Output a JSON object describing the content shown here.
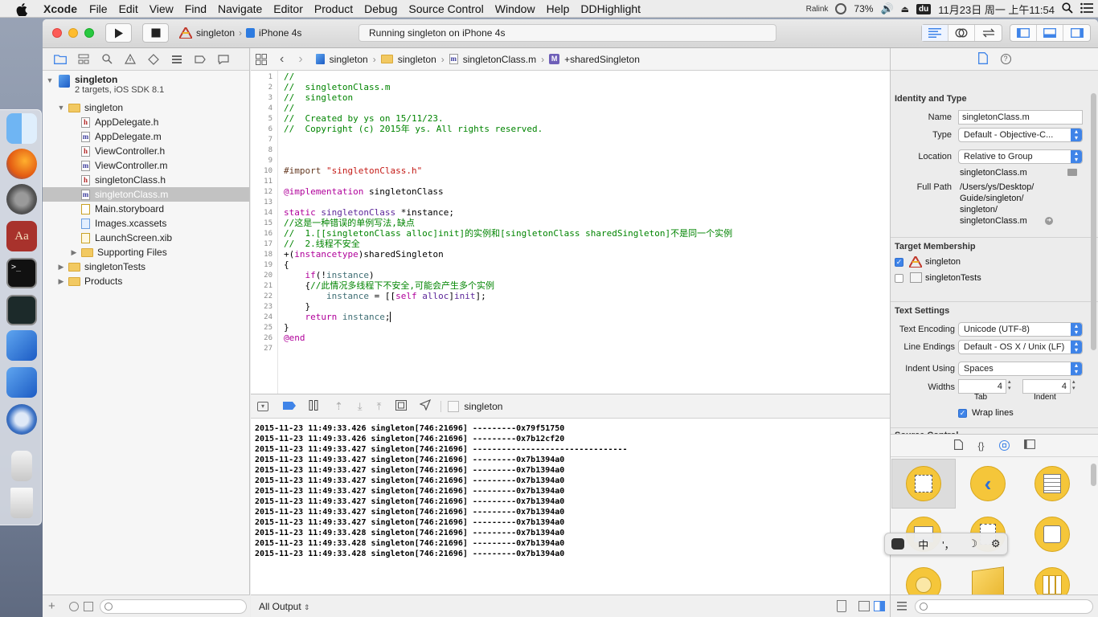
{
  "menubar": {
    "app_name": "Xcode",
    "items": [
      "File",
      "Edit",
      "View",
      "Find",
      "Navigate",
      "Editor",
      "Product",
      "Debug",
      "Source Control",
      "Window",
      "Help",
      "DDHighlight"
    ],
    "wifi_label": "Ralink",
    "battery": "73%",
    "baidu": "du",
    "datetime": "11月23日 周一 上午11:54"
  },
  "toolbar": {
    "scheme_target": "singleton",
    "scheme_device": "iPhone 4s",
    "activity": "Running singleton on iPhone 4s"
  },
  "navigator": {
    "project_name": "singleton",
    "project_subtitle": "2 targets, iOS SDK 8.1",
    "items": [
      {
        "label": "singleton",
        "kind": "folder",
        "indent": 1,
        "open": true
      },
      {
        "label": "AppDelegate.h",
        "kind": "h",
        "indent": 2
      },
      {
        "label": "AppDelegate.m",
        "kind": "m",
        "indent": 2
      },
      {
        "label": "ViewController.h",
        "kind": "h",
        "indent": 2
      },
      {
        "label": "ViewController.m",
        "kind": "m",
        "indent": 2
      },
      {
        "label": "singletonClass.h",
        "kind": "h",
        "indent": 2
      },
      {
        "label": "singletonClass.m",
        "kind": "m",
        "indent": 2,
        "selected": true
      },
      {
        "label": "Main.storyboard",
        "kind": "storyboard",
        "indent": 2
      },
      {
        "label": "Images.xcassets",
        "kind": "assets",
        "indent": 2
      },
      {
        "label": "LaunchScreen.xib",
        "kind": "xib",
        "indent": 2
      },
      {
        "label": "Supporting Files",
        "kind": "folder",
        "indent": 2,
        "open": false
      },
      {
        "label": "singletonTests",
        "kind": "folder",
        "indent": 1,
        "open": false
      },
      {
        "label": "Products",
        "kind": "folder",
        "indent": 1,
        "open": false
      }
    ]
  },
  "jumpbar": {
    "crumbs": [
      "singleton",
      "singleton",
      "singletonClass.m",
      "+sharedSingleton"
    ]
  },
  "code_lines": [
    {
      "n": "1",
      "t": "//",
      "c": "com"
    },
    {
      "n": "2",
      "t": "//  singletonClass.m",
      "c": "com"
    },
    {
      "n": "3",
      "t": "//  singleton",
      "c": "com"
    },
    {
      "n": "4",
      "t": "//",
      "c": "com"
    },
    {
      "n": "5",
      "t": "//  Created by ys on 15/11/23.",
      "c": "com"
    },
    {
      "n": "6",
      "t": "//  Copyright (c) 2015年 ys. All rights reserved.",
      "c": "com"
    },
    {
      "n": "7",
      "t": "",
      "c": ""
    },
    {
      "n": "8",
      "t": "",
      "c": ""
    },
    {
      "n": "9",
      "t": "",
      "c": ""
    },
    {
      "n": "10",
      "t": "#import \"singletonClass.h\"",
      "c": "import"
    },
    {
      "n": "11",
      "t": "",
      "c": ""
    },
    {
      "n": "12",
      "t": "@implementation singletonClass",
      "c": "impl"
    },
    {
      "n": "13",
      "t": "",
      "c": ""
    },
    {
      "n": "14",
      "t": "static singletonClass *instance;",
      "c": "static"
    },
    {
      "n": "15",
      "t": "//这是一种错误的单例写法,缺点",
      "c": "com"
    },
    {
      "n": "16",
      "t": "//  1.[[singletonClass alloc]init]的实例和[singletonClass sharedSingleton]不是同一个实例",
      "c": "com"
    },
    {
      "n": "17",
      "t": "//  2.线程不安全",
      "c": "com"
    },
    {
      "n": "18",
      "t": "+(instancetype)sharedSingleton",
      "c": "method"
    },
    {
      "n": "19",
      "t": "{",
      "c": ""
    },
    {
      "n": "20",
      "t": "    if(!instance)",
      "c": "if"
    },
    {
      "n": "21",
      "t": "    {//此情况多线程下不安全,可能会产生多个实例",
      "c": "brace-com"
    },
    {
      "n": "22",
      "t": "        instance = [[self alloc]init];",
      "c": "assign"
    },
    {
      "n": "23",
      "t": "    }",
      "c": ""
    },
    {
      "n": "24",
      "t": "    return instance;",
      "c": "return"
    },
    {
      "n": "25",
      "t": "}",
      "c": ""
    },
    {
      "n": "26",
      "t": "@end",
      "c": "end"
    },
    {
      "n": "27",
      "t": "",
      "c": ""
    }
  ],
  "debugbar": {
    "process": "singleton"
  },
  "console_lines": [
    "2015-11-23 11:49:33.426 singleton[746:21696] ---------0x79f51750",
    "2015-11-23 11:49:33.426 singleton[746:21696] ---------0x7b12cf20",
    "2015-11-23 11:49:33.427 singleton[746:21696] --------------------------------",
    "2015-11-23 11:49:33.427 singleton[746:21696] ---------0x7b1394a0",
    "2015-11-23 11:49:33.427 singleton[746:21696] ---------0x7b1394a0",
    "2015-11-23 11:49:33.427 singleton[746:21696] ---------0x7b1394a0",
    "2015-11-23 11:49:33.427 singleton[746:21696] ---------0x7b1394a0",
    "2015-11-23 11:49:33.427 singleton[746:21696] ---------0x7b1394a0",
    "2015-11-23 11:49:33.427 singleton[746:21696] ---------0x7b1394a0",
    "2015-11-23 11:49:33.427 singleton[746:21696] ---------0x7b1394a0",
    "2015-11-23 11:49:33.428 singleton[746:21696] ---------0x7b1394a0",
    "2015-11-23 11:49:33.428 singleton[746:21696] ---------0x7b1394a0",
    "2015-11-23 11:49:33.428 singleton[746:21696] ---------0x7b1394a0"
  ],
  "console_footer": {
    "output_filter": "All Output"
  },
  "inspector": {
    "identity_title": "Identity and Type",
    "name_label": "Name",
    "name_value": "singletonClass.m",
    "type_label": "Type",
    "type_value": "Default - Objective-C...",
    "location_label": "Location",
    "location_value": "Relative to Group",
    "location_file": "singletonClass.m",
    "fullpath_label": "Full Path",
    "fullpath_lines": [
      "/Users/ys/Desktop/",
      "Guide/singleton/",
      "singleton/",
      "singletonClass.m"
    ],
    "target_title": "Target Membership",
    "targets": [
      {
        "label": "singleton",
        "checked": true
      },
      {
        "label": "singletonTests",
        "checked": false
      }
    ],
    "text_title": "Text Settings",
    "encoding_label": "Text Encoding",
    "encoding_value": "Unicode (UTF-8)",
    "endings_label": "Line Endings",
    "endings_value": "Default - OS X / Unix (LF)",
    "indent_label": "Indent Using",
    "indent_value": "Spaces",
    "widths_label": "Widths",
    "tab_value": "4",
    "indent_width_value": "4",
    "tab_caption": "Tab",
    "indent_caption": "Indent",
    "wrap_label": "Wrap lines",
    "source_title": "Source Control"
  },
  "ime": {
    "zh": "中",
    "punct": "'，",
    "moon": "☽",
    "gear": "⚙"
  },
  "colors": {
    "accent": "#3f84e8",
    "library_icon": "#f5c63a",
    "selection": "#d4d4d4"
  }
}
